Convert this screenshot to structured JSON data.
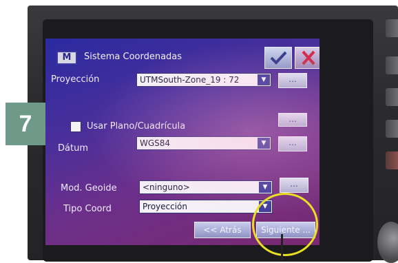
{
  "step_badge": "7",
  "window": {
    "title_icon": "M",
    "title": "Sistema Coordenadas"
  },
  "icons": {
    "ok": "check-icon",
    "close": "close-icon",
    "dropdown": "chevron-down-icon"
  },
  "fields": {
    "proyeccion": {
      "label": "Proyección",
      "value": "UTMSouth-Zone_19 : 72"
    },
    "usar_plano": {
      "label": "Usar Plano/Cuadrícula",
      "checked": false
    },
    "datum": {
      "label": "Dátum",
      "value": "WGS84"
    },
    "geoide": {
      "label": "Mod. Geoide",
      "value": "<ninguno>"
    },
    "tipo_coord": {
      "label": "Tipo Coord",
      "value": "Proyección"
    }
  },
  "buttons": {
    "dots": "...",
    "back": "<< Atrás",
    "next": "Siguiente ..."
  },
  "colors": {
    "badge": "#6f9a8a",
    "highlight": "#e8e020"
  }
}
